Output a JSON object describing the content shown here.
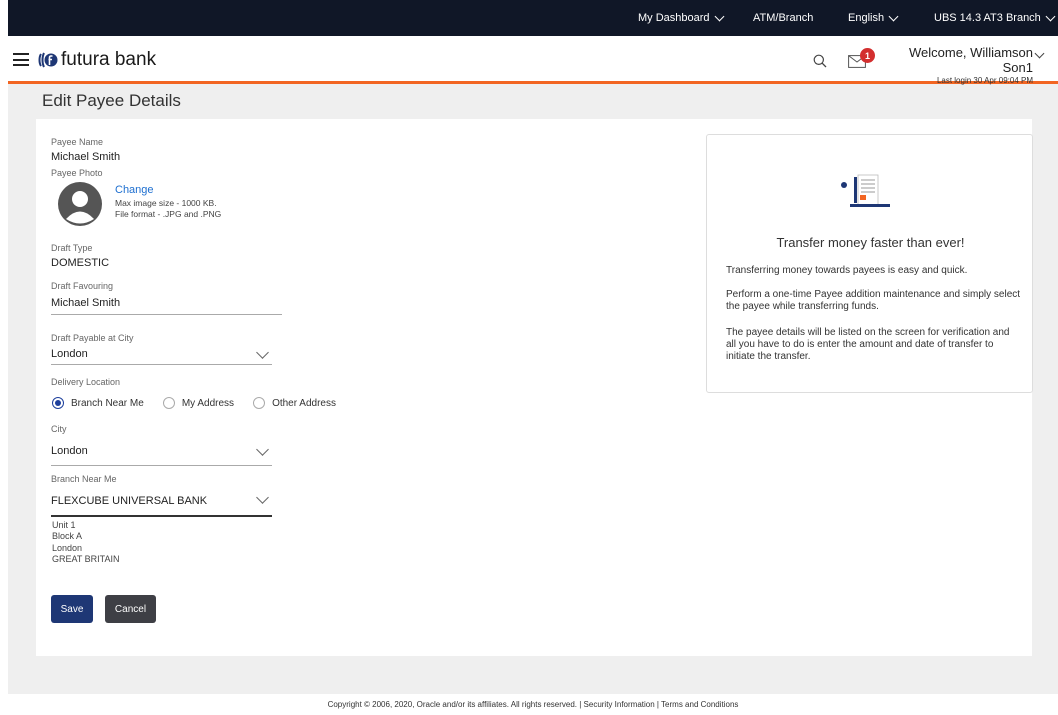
{
  "topbar": {
    "dashboard": "My Dashboard",
    "atm_branch": "ATM/Branch",
    "language": "English",
    "branch": "UBS 14.3 AT3 Branch"
  },
  "header": {
    "brand": "futura bank",
    "notification_count": "1",
    "welcome": "Welcome, Williamson Son1",
    "last_login": "Last login 30 Apr 09:04 PM"
  },
  "page": {
    "title": "Edit Payee Details"
  },
  "form": {
    "payee_name_label": "Payee Name",
    "payee_name": "Michael Smith",
    "payee_photo_label": "Payee Photo",
    "change_link": "Change",
    "max_size": "Max image size - 1000 KB.",
    "file_format": "File format - .JPG and .PNG",
    "draft_type_label": "Draft Type",
    "draft_type": "DOMESTIC",
    "draft_favouring_label": "Draft Favouring",
    "draft_favouring": "Michael Smith",
    "payable_city_label": "Draft Payable at City",
    "payable_city": "London",
    "delivery_location_label": "Delivery Location",
    "delivery_options": [
      "Branch Near Me",
      "My Address",
      "Other Address"
    ],
    "delivery_selected": "Branch Near Me",
    "city_label": "City",
    "city": "London",
    "branch_label": "Branch Near Me",
    "branch": "FLEXCUBE UNIVERSAL BANK",
    "address": [
      "Unit 1",
      "Block A",
      "London",
      "GREAT BRITAIN"
    ],
    "save": "Save",
    "cancel": "Cancel"
  },
  "info": {
    "title": "Transfer money faster than ever!",
    "p1": "Transferring money towards payees is easy and quick.",
    "p2": "Perform a one-time Payee addition maintenance and simply select the payee while transferring funds.",
    "p3": "The payee details will be listed on the screen for verification and all you have to do is enter the amount and date of transfer to initiate the transfer."
  },
  "footer": {
    "text": "Copyright © 2006, 2020, Oracle and/or its affiliates. All rights reserved. | Security Information | Terms and Conditions"
  },
  "colors": {
    "topbar": "#101727",
    "accent": "#f26522",
    "primary_button": "#1e3775",
    "secondary_button": "#3e3f45",
    "link": "#1e6fd0",
    "badge": "#d32f2f"
  },
  "icons": [
    "hamburger-icon",
    "brand-logo-icon",
    "search-icon",
    "mail-icon",
    "avatar-icon",
    "chevron-down-icon",
    "document-illustration"
  ]
}
